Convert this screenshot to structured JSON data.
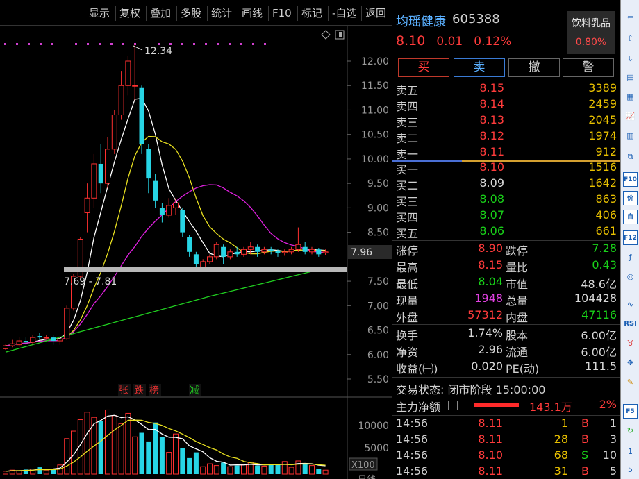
{
  "toolbar": {
    "buttons": [
      "显示",
      "复权",
      "叠加",
      "多股",
      "统计",
      "画线",
      "F10",
      "标记",
      "-自选",
      "返回"
    ]
  },
  "stock": {
    "name": "均瑶健康",
    "code": "605388",
    "price": "8.10",
    "change": "0.01",
    "change_pct": "0.12%",
    "sector_name": "饮料乳品",
    "sector_change": "0.80%"
  },
  "actions": {
    "buy": "买",
    "sell": "卖",
    "cancel": "撤",
    "alert": "警"
  },
  "order_book": {
    "asks": [
      {
        "label": "卖五",
        "price": "8.15",
        "volume": "3389",
        "color": "red"
      },
      {
        "label": "卖四",
        "price": "8.14",
        "volume": "2459",
        "color": "red"
      },
      {
        "label": "卖三",
        "price": "8.13",
        "volume": "2045",
        "color": "red"
      },
      {
        "label": "卖二",
        "price": "8.12",
        "volume": "1974",
        "color": "red"
      },
      {
        "label": "卖一",
        "price": "8.11",
        "volume": "912",
        "color": "red"
      }
    ],
    "bids": [
      {
        "label": "买一",
        "price": "8.10",
        "volume": "1516",
        "color": "red"
      },
      {
        "label": "买二",
        "price": "8.09",
        "volume": "1642",
        "color": "white"
      },
      {
        "label": "买三",
        "price": "8.08",
        "volume": "863",
        "color": "green"
      },
      {
        "label": "买四",
        "price": "8.07",
        "volume": "406",
        "color": "green"
      },
      {
        "label": "买五",
        "price": "8.06",
        "volume": "661",
        "color": "green"
      }
    ]
  },
  "stats": [
    {
      "l1": "涨停",
      "v1": "8.90",
      "c1": "red",
      "l2": "跌停",
      "v2": "7.28",
      "c2": "green"
    },
    {
      "l1": "最高",
      "v1": "8.15",
      "c1": "red",
      "l2": "量比",
      "v2": "0.43",
      "c2": "green"
    },
    {
      "l1": "最低",
      "v1": "8.04",
      "c1": "green",
      "l2": "市值",
      "v2": "48.6亿",
      "c2": "white"
    },
    {
      "l1": "现量",
      "v1": "1948",
      "c1": "magenta",
      "l2": "总量",
      "v2": "104428",
      "c2": "white"
    },
    {
      "l1": "外盘",
      "v1": "57312",
      "c1": "red",
      "l2": "内盘",
      "v2": "47116",
      "c2": "green"
    }
  ],
  "stats2": [
    {
      "l1": "换手",
      "v1": "1.74%",
      "c1": "white",
      "l2": "股本",
      "v2": "6.00亿",
      "c2": "white"
    },
    {
      "l1": "净资",
      "v1": "2.96",
      "c1": "white",
      "l2": "流通",
      "v2": "6.00亿",
      "c2": "white"
    },
    {
      "l1": "收益(㈠)",
      "v1": "0.020",
      "c1": "white",
      "l2": "PE(动)",
      "v2": "111.5",
      "c2": "white"
    }
  ],
  "trade_status": "交易状态: 闭市阶段 15:00:00",
  "main_flow": {
    "label": "主力净额",
    "value": "143.1万",
    "pct": "2%"
  },
  "ticks": [
    {
      "time": "14:56",
      "price": "8.11",
      "vol": "1",
      "side": "B",
      "side_color": "red",
      "num": "1"
    },
    {
      "time": "14:56",
      "price": "8.11",
      "vol": "28",
      "side": "B",
      "side_color": "red",
      "num": "3"
    },
    {
      "time": "14:56",
      "price": "8.10",
      "vol": "68",
      "side": "S",
      "side_color": "green",
      "num": "10"
    },
    {
      "time": "14:56",
      "price": "8.11",
      "vol": "31",
      "side": "B",
      "side_color": "red",
      "num": "5"
    }
  ],
  "chart": {
    "high_label": "12.34",
    "range_label": "7.69 - 7.81",
    "current_price_tag": "7.96",
    "y_ticks": [
      "12.00",
      "11.50",
      "11.00",
      "10.50",
      "10.00",
      "9.50",
      "9.00",
      "8.50",
      "7.50",
      "7.00",
      "6.50",
      "6.00",
      "5.50"
    ],
    "vol_ticks": [
      "10000",
      "5000"
    ],
    "vol_unit": "X100",
    "markers": [
      {
        "text": "张",
        "color": "#e03030"
      },
      {
        "text": "跌",
        "color": "#e03030"
      },
      {
        "text": "榜",
        "color": "#e03030"
      },
      {
        "text": "减",
        "color": "#20c020"
      }
    ],
    "bottom_label": "日线"
  },
  "chart_data": {
    "type": "candlestick",
    "y_range": [
      5.5,
      12.34
    ],
    "candles": [
      {
        "o": 6.12,
        "c": 6.18,
        "h": 6.2,
        "l": 6.1
      },
      {
        "o": 6.18,
        "c": 6.22,
        "h": 6.3,
        "l": 6.15
      },
      {
        "o": 6.2,
        "c": 6.28,
        "h": 6.35,
        "l": 6.15
      },
      {
        "o": 6.28,
        "c": 6.25,
        "h": 6.35,
        "l": 6.2
      },
      {
        "o": 6.25,
        "c": 6.35,
        "h": 6.4,
        "l": 6.2
      },
      {
        "o": 6.38,
        "c": 6.35,
        "h": 6.45,
        "l": 6.3
      },
      {
        "o": 6.35,
        "c": 6.35,
        "h": 6.4,
        "l": 6.3
      },
      {
        "o": 6.35,
        "c": 6.28,
        "h": 6.4,
        "l": 6.2
      },
      {
        "o": 6.28,
        "c": 6.32,
        "h": 6.38,
        "l": 6.2
      },
      {
        "o": 6.32,
        "c": 6.95,
        "h": 7.0,
        "l": 6.3
      },
      {
        "o": 6.95,
        "c": 7.6,
        "h": 7.65,
        "l": 6.9
      },
      {
        "o": 7.6,
        "c": 8.36,
        "h": 8.4,
        "l": 7.55
      },
      {
        "o": 8.9,
        "c": 9.2,
        "h": 9.5,
        "l": 8.5
      },
      {
        "o": 9.2,
        "c": 9.9,
        "h": 10.1,
        "l": 9.0
      },
      {
        "o": 9.9,
        "c": 9.5,
        "h": 10.3,
        "l": 9.3
      },
      {
        "o": 9.5,
        "c": 10.2,
        "h": 10.45,
        "l": 9.4
      },
      {
        "o": 10.2,
        "c": 10.9,
        "h": 11.0,
        "l": 10.1
      },
      {
        "o": 10.9,
        "c": 11.5,
        "h": 11.8,
        "l": 10.8
      },
      {
        "o": 11.5,
        "c": 12.0,
        "h": 12.1,
        "l": 11.3
      },
      {
        "o": 11.5,
        "c": 11.5,
        "h": 12.34,
        "l": 11.2
      },
      {
        "o": 11.45,
        "c": 10.3,
        "h": 11.5,
        "l": 10.1
      },
      {
        "o": 10.2,
        "c": 9.6,
        "h": 10.3,
        "l": 9.3
      },
      {
        "o": 9.55,
        "c": 9.15,
        "h": 9.7,
        "l": 9.0
      },
      {
        "o": 9.0,
        "c": 8.85,
        "h": 9.1,
        "l": 8.7
      },
      {
        "o": 8.85,
        "c": 9.05,
        "h": 9.2,
        "l": 8.8
      },
      {
        "o": 9.0,
        "c": 9.1,
        "h": 9.2,
        "l": 8.85
      },
      {
        "o": 8.95,
        "c": 8.5,
        "h": 9.0,
        "l": 8.4
      },
      {
        "o": 8.4,
        "c": 8.1,
        "h": 8.45,
        "l": 8.0
      },
      {
        "o": 8.05,
        "c": 7.85,
        "h": 8.1,
        "l": 7.8
      },
      {
        "o": 7.78,
        "c": 7.9,
        "h": 7.95,
        "l": 7.69
      },
      {
        "o": 7.9,
        "c": 8.0,
        "h": 8.05,
        "l": 7.85
      },
      {
        "o": 8.0,
        "c": 8.25,
        "h": 8.3,
        "l": 7.95
      },
      {
        "o": 8.2,
        "c": 8.0,
        "h": 8.25,
        "l": 7.85
      },
      {
        "o": 8.0,
        "c": 8.1,
        "h": 8.15,
        "l": 7.95
      },
      {
        "o": 8.1,
        "c": 8.05,
        "h": 8.2,
        "l": 8.0
      },
      {
        "o": 8.05,
        "c": 8.15,
        "h": 8.2,
        "l": 8.0
      },
      {
        "o": 8.15,
        "c": 8.2,
        "h": 8.3,
        "l": 8.05
      },
      {
        "o": 8.2,
        "c": 8.1,
        "h": 8.25,
        "l": 8.0
      },
      {
        "o": 8.1,
        "c": 8.15,
        "h": 8.2,
        "l": 8.05
      },
      {
        "o": 8.15,
        "c": 8.12,
        "h": 8.2,
        "l": 8.05
      },
      {
        "o": 8.12,
        "c": 8.08,
        "h": 8.15,
        "l": 8.0
      },
      {
        "o": 8.08,
        "c": 8.1,
        "h": 8.15,
        "l": 8.02
      },
      {
        "o": 8.1,
        "c": 8.15,
        "h": 8.2,
        "l": 8.05
      },
      {
        "o": 8.15,
        "c": 8.25,
        "h": 8.6,
        "l": 8.1
      },
      {
        "o": 8.2,
        "c": 8.1,
        "h": 8.3,
        "l": 8.05
      },
      {
        "o": 8.1,
        "c": 8.15,
        "h": 8.2,
        "l": 8.05
      },
      {
        "o": 8.15,
        "c": 8.05,
        "h": 8.18,
        "l": 8.0
      },
      {
        "o": 8.08,
        "c": 8.1,
        "h": 8.15,
        "l": 8.04
      }
    ],
    "volumes": [
      500,
      700,
      600,
      800,
      900,
      1200,
      700,
      900,
      1600,
      6200,
      7500,
      9500,
      10800,
      9900,
      9200,
      11200,
      10200,
      8800,
      10600,
      6500,
      7200,
      5700,
      9000,
      6500,
      3800,
      7000,
      4600,
      2800,
      3800,
      1300,
      1800,
      1500,
      2000,
      1300,
      1500,
      1700,
      2100,
      1500,
      1400,
      1700,
      1800,
      2200,
      1200,
      2300,
      1900,
      1500,
      900,
      700
    ]
  }
}
